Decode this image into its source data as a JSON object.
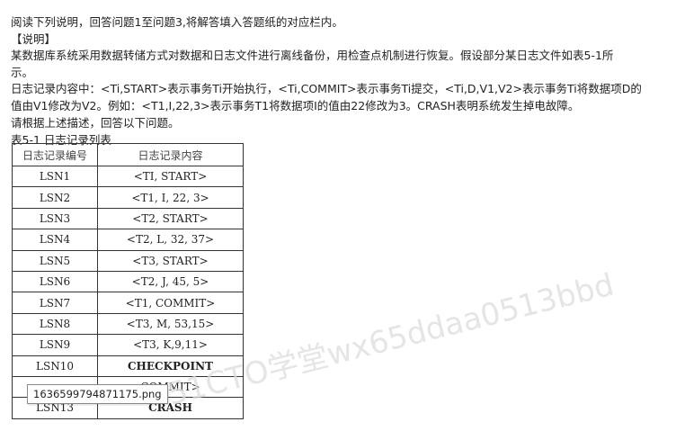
{
  "intro": "阅读下列说明，回答问题1至问题3,将解答填入答题纸的对应栏内。",
  "section_label": "【说明】",
  "description_line1": "某数据库系统采用数据转储方式对数据和日志文件进行离线备份，用检查点机制进行恢复。假设部分某日志文件如表5-1所",
  "description_line2": "示。",
  "log_format_line1": "日志记录内容中：<Ti,START>表示事务Ti开始执行，<Ti,COMMIT>表示事务Ti提交，<Ti,D,V1,V2>表示事务Ti将数据项D的",
  "log_format_line2": "值由V1修改为V2。例如：<T1,I,22,3>表示事务T1将数据项I的值由22修改为3。CRASH表明系统发生掉电故障。",
  "instruction": "请根据上述描述，回答以下问题。",
  "table_caption": "表5-1 日志记录列表",
  "table": {
    "headers": [
      "日志记录编号",
      "日志记录内容"
    ],
    "rows": [
      {
        "lsn": "LSN1",
        "content": "<TI, START>"
      },
      {
        "lsn": "LSN2",
        "content": "<T1, I, 22, 3>"
      },
      {
        "lsn": "LSN3",
        "content": "<T2, START>"
      },
      {
        "lsn": "LSN4",
        "content": "<T2, L, 32, 37>"
      },
      {
        "lsn": "LSN5",
        "content": "<T3, START>"
      },
      {
        "lsn": "LSN6",
        "content": "<T2, J, 45, 5>"
      },
      {
        "lsn": "LSN7",
        "content": "<T1, COMMIT>"
      },
      {
        "lsn": "LSN8",
        "content": "<T3, M, 53,15>"
      },
      {
        "lsn": "LSN9",
        "content": "<T3, K,9,11>"
      },
      {
        "lsn": "LSN10",
        "content": "CHECKPOINT"
      },
      {
        "lsn": "",
        "content": "COMMIT>"
      },
      {
        "lsn": "LSN13",
        "content": "CRASH"
      }
    ]
  },
  "file_label": "1636599794871175.png",
  "watermark_text": "51CTO学堂wx65ddaa0513bbd",
  "colors": {
    "text": "#222222",
    "border": "#333333",
    "watermark": "#d9d9d9"
  }
}
